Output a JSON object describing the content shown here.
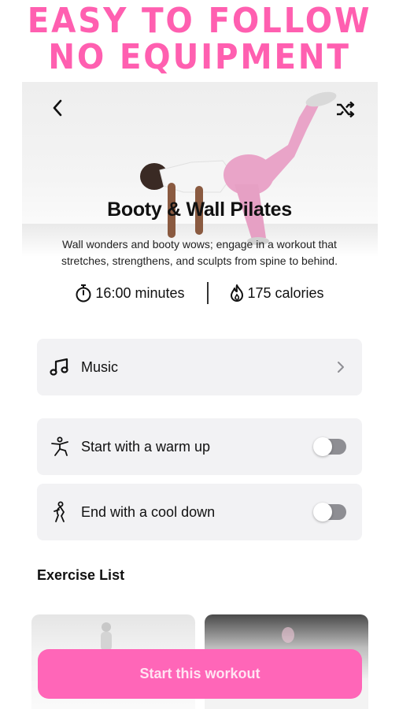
{
  "promo": {
    "line1": "EASY TO FOLLOW",
    "line2": "NO EQUIPMENT"
  },
  "header": {
    "back_icon": "chevron-left-icon",
    "shuffle_icon": "shuffle-icon"
  },
  "workout": {
    "title": "Booty & Wall Pilates",
    "description": "Wall wonders and booty wows; engage in a workout that stretches, strengthens, and sculpts from spine to behind.",
    "duration": "16:00 minutes",
    "calories": "175 calories"
  },
  "options": {
    "music_label": "Music",
    "warmup_label": "Start with a warm up",
    "warmup_on": false,
    "cooldown_label": "End with a cool down",
    "cooldown_on": false
  },
  "exercise_list": {
    "title": "Exercise List"
  },
  "cta": {
    "label": "Start this workout"
  },
  "colors": {
    "accent": "#ff66b8",
    "promo": "#ff5fb0",
    "card": "#f2f2f4",
    "toggle_off": "#8e8e93"
  }
}
